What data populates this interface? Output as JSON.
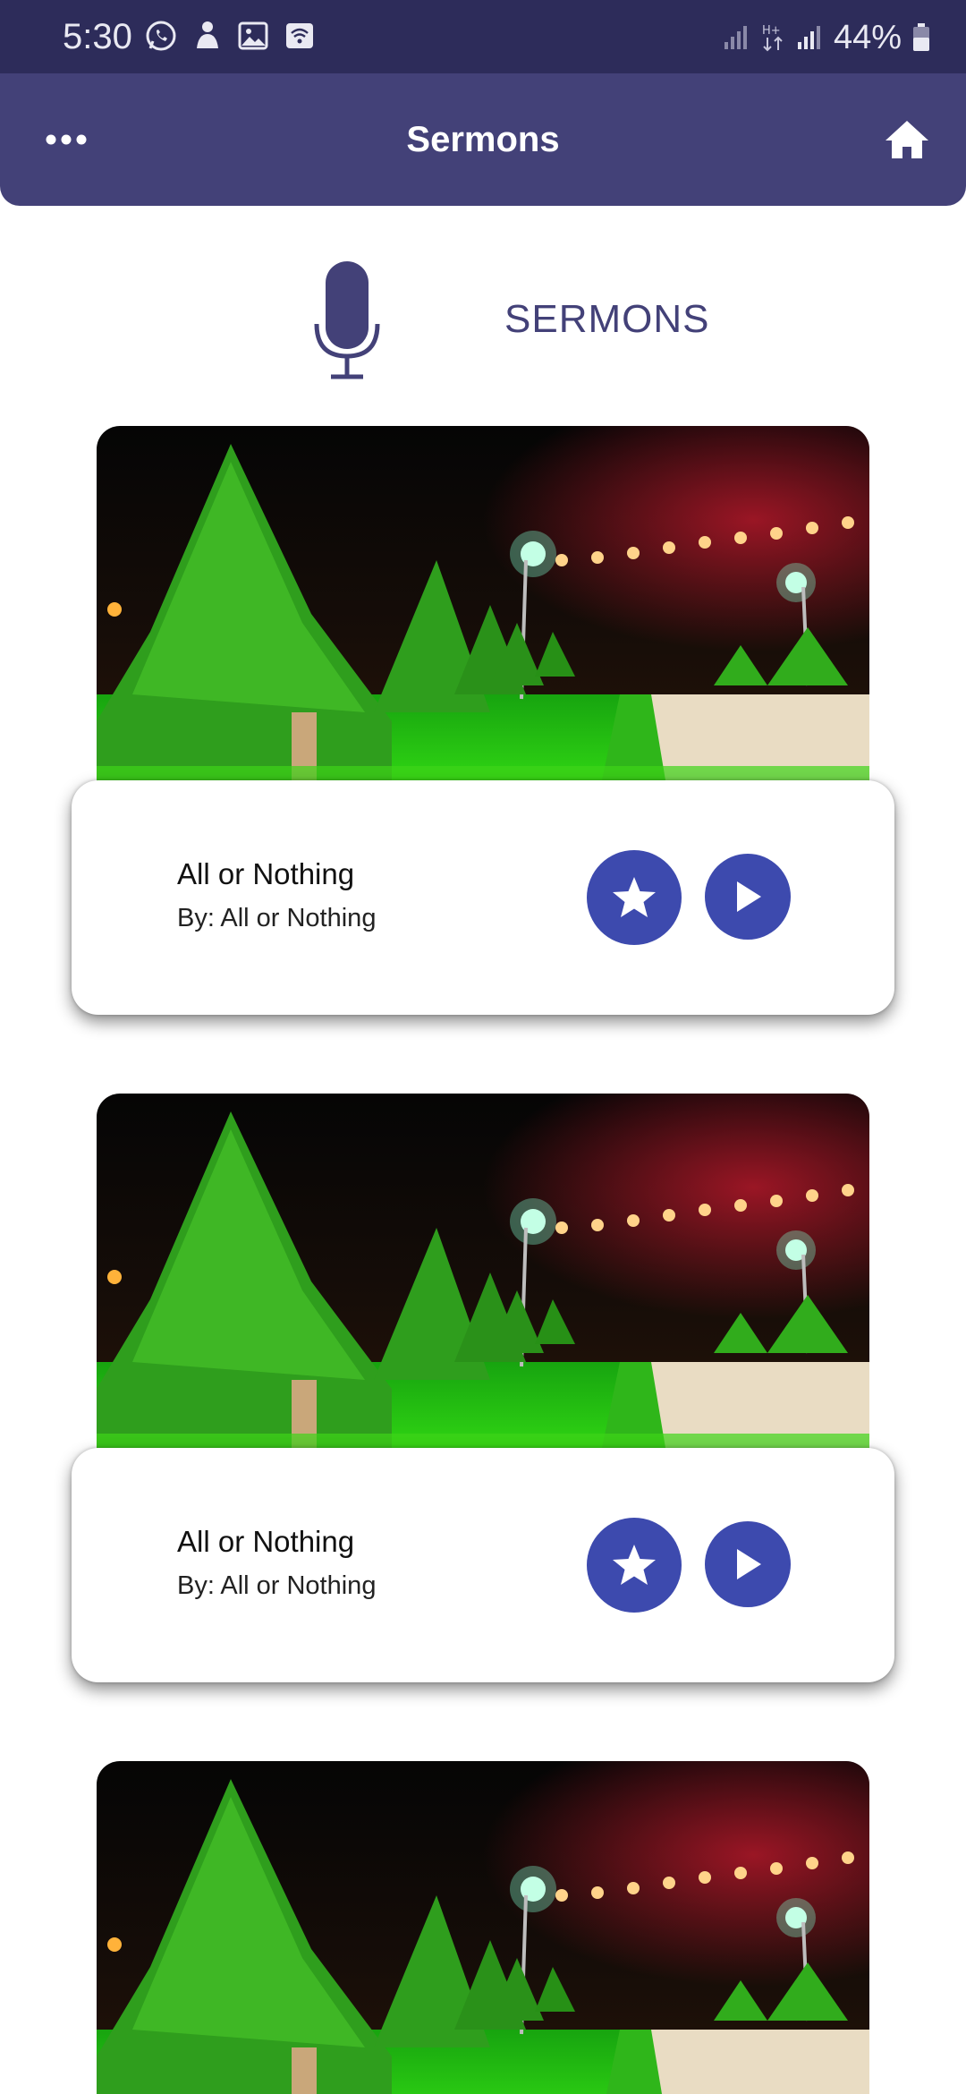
{
  "status_bar": {
    "time": "5:30",
    "battery": "44%"
  },
  "header": {
    "title": "Sermons",
    "menu_icon": "more-horizontal-icon",
    "home_icon": "home-icon"
  },
  "section": {
    "title": "SERMONS",
    "icon": "microphone-icon"
  },
  "colors": {
    "status_bar": "#2d2c5a",
    "app_bar": "#434178",
    "accent": "#3d4aae",
    "section_text": "#434178"
  },
  "sermons": [
    {
      "title": "All or Nothing",
      "by": "By: All or Nothing"
    },
    {
      "title": "All or Nothing",
      "by": "By: All or Nothing"
    },
    {
      "title": "",
      "by": ""
    }
  ]
}
